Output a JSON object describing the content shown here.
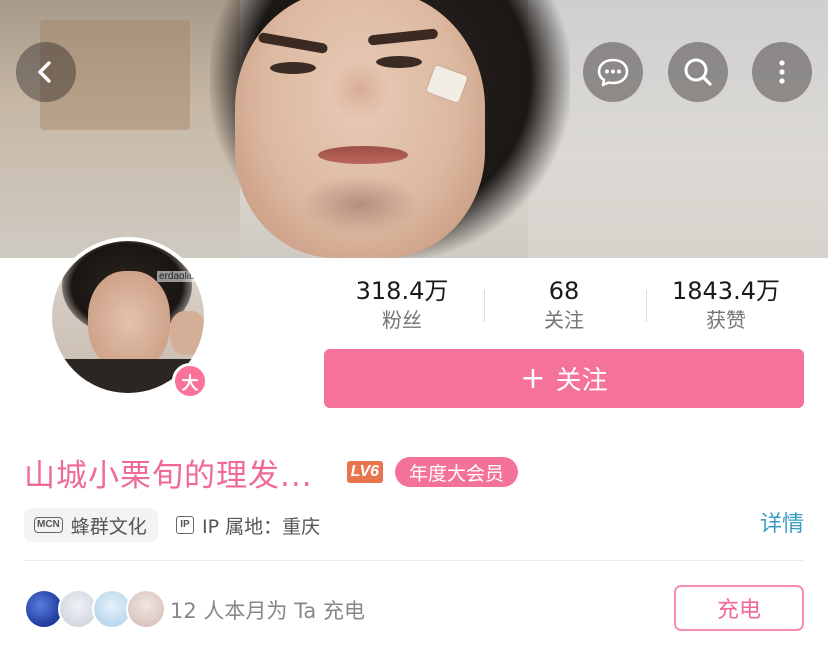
{
  "top_bar": {
    "back_icon": "chevron-left-icon",
    "message_icon": "chat-bubble-icon",
    "search_icon": "search-icon",
    "more_icon": "more-vertical-icon"
  },
  "profile": {
    "avatar_watermark": "erdaoliu123",
    "avatar_badge": "大",
    "stats": [
      {
        "value": "318.4万",
        "label": "粉丝"
      },
      {
        "value": "68",
        "label": "关注"
      },
      {
        "value": "1843.4万",
        "label": "获赞"
      }
    ],
    "follow_button": {
      "plus": "+",
      "label": "关注"
    },
    "name": "山城小栗旬的理发...",
    "level_badge": "LV6",
    "vip_badge": "年度大会员",
    "mcn_icon": "MCN",
    "mcn_label": "蜂群文化",
    "ip_icon": "IP",
    "ip_label": "IP 属地：重庆",
    "detail_link": "详情"
  },
  "charge": {
    "text": "12 人本月为 Ta 充电",
    "button": "充电"
  },
  "colors": {
    "brand_pink": "#f5729b",
    "link_blue": "#3a9bc7",
    "level_orange": "#e9754f"
  }
}
